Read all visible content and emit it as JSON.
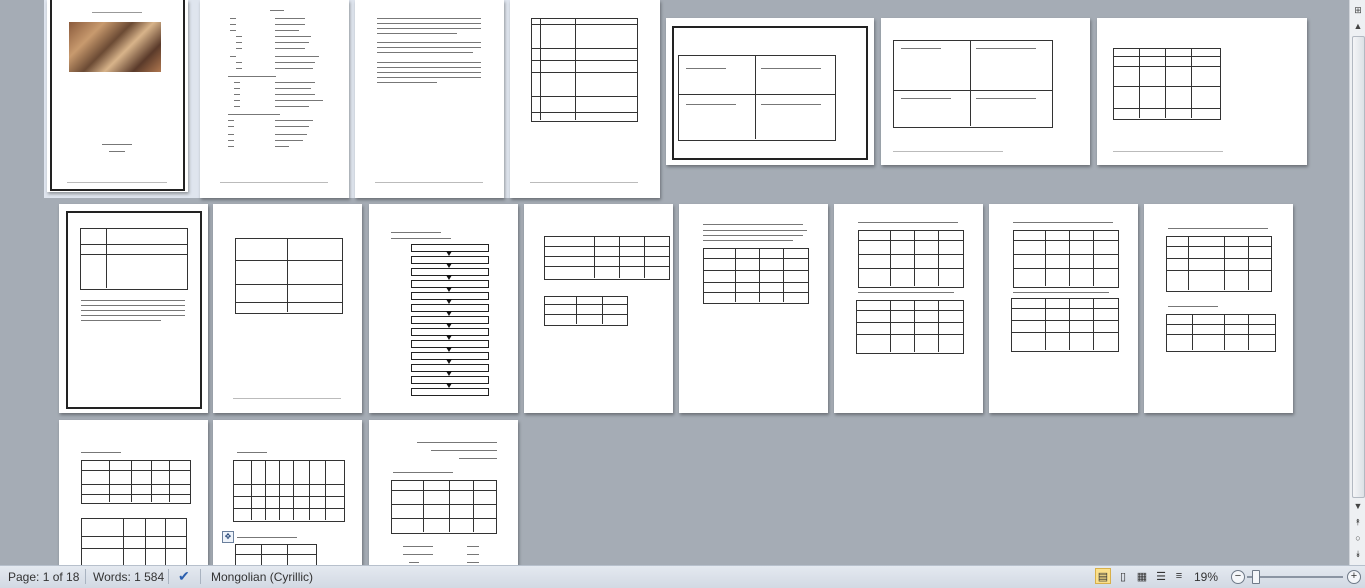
{
  "status_bar": {
    "page": "Page: 1 of 18",
    "words": "Words: 1 584",
    "language": "Mongolian (Cyrillic)",
    "zoom": "19%",
    "zoom_out": "−",
    "zoom_in": "+"
  },
  "view_buttons": [
    "print-layout",
    "full-screen-reading",
    "web-layout",
    "outline",
    "draft"
  ],
  "document": {
    "page_count": 18,
    "current_page": 1
  },
  "colors": {
    "workspace": "#a5acb5",
    "selection": "#dfe5ee",
    "statusbar": "#dbe1ea"
  }
}
